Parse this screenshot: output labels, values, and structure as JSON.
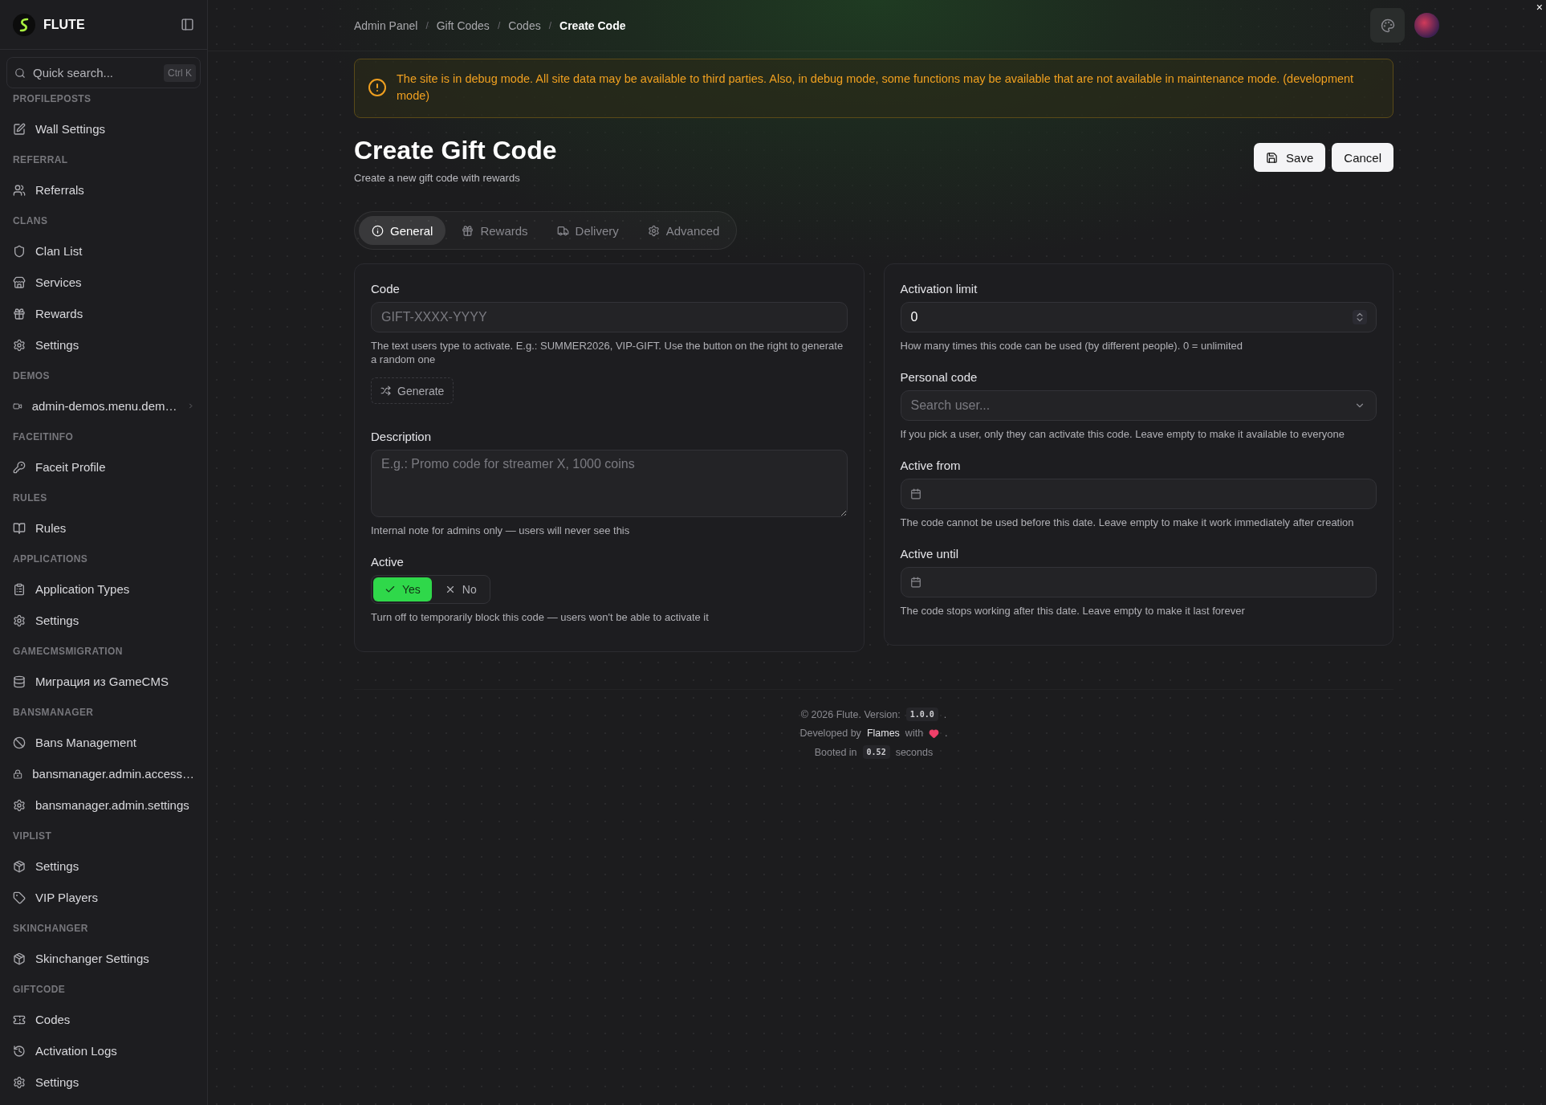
{
  "corner_close": "×",
  "sidebar": {
    "brand": "FLUTE",
    "search": {
      "placeholder": "Quick search...",
      "shortcut": "Ctrl K"
    },
    "sections": [
      {
        "title": "PROFILEPOSTS",
        "items": [
          {
            "label": "Wall Settings"
          }
        ]
      },
      {
        "title": "REFERRAL",
        "items": [
          {
            "label": "Referrals"
          }
        ]
      },
      {
        "title": "CLANS",
        "items": [
          {
            "label": "Clan List"
          },
          {
            "label": "Services"
          },
          {
            "label": "Rewards"
          },
          {
            "label": "Settings"
          }
        ]
      },
      {
        "title": "DEMOS",
        "items": [
          {
            "label": "admin-demos.menu.dem…",
            "expandable": true
          }
        ]
      },
      {
        "title": "FACEITINFO",
        "items": [
          {
            "label": "Faceit Profile"
          }
        ]
      },
      {
        "title": "RULES",
        "items": [
          {
            "label": "Rules"
          }
        ]
      },
      {
        "title": "APPLICATIONS",
        "items": [
          {
            "label": "Application Types"
          },
          {
            "label": "Settings"
          }
        ]
      },
      {
        "title": "GAMECMSMIGRATION",
        "items": [
          {
            "label": "Миграция из GameCMS"
          }
        ]
      },
      {
        "title": "BANSMANAGER",
        "items": [
          {
            "label": "Bans Management"
          },
          {
            "label": "bansmanager.admin.access…"
          },
          {
            "label": "bansmanager.admin.settings"
          }
        ]
      },
      {
        "title": "VIPLIST",
        "items": [
          {
            "label": "Settings"
          },
          {
            "label": "VIP Players"
          }
        ]
      },
      {
        "title": "SKINCHANGER",
        "items": [
          {
            "label": "Skinchanger Settings"
          }
        ]
      },
      {
        "title": "GIFTCODE",
        "items": [
          {
            "label": "Codes"
          },
          {
            "label": "Activation Logs"
          },
          {
            "label": "Settings"
          }
        ]
      }
    ]
  },
  "breadcrumbs": {
    "separator": "/",
    "items": [
      "Admin Panel",
      "Gift Codes",
      "Codes",
      "Create Code"
    ]
  },
  "alert": "The site is in debug mode. All site data may be available to third parties. Also, in debug mode, some functions may be available that are not available in maintenance mode. (development mode)",
  "page": {
    "title": "Create Gift Code",
    "subtitle": "Create a new gift code with rewards",
    "buttons": [
      {
        "label": "Save",
        "kind": "save"
      },
      {
        "label": "Cancel",
        "kind": "plain"
      }
    ]
  },
  "tabs": [
    {
      "label": "General",
      "selected": true
    },
    {
      "label": "Rewards",
      "selected": false
    },
    {
      "label": "Delivery",
      "selected": false
    },
    {
      "label": "Advanced",
      "selected": false
    }
  ],
  "columns": [
    [
      {
        "kind": "text",
        "label": "Code",
        "placeholder": "GIFT-XXXX-YYYY",
        "help": "The text users type to activate. E.g.: SUMMER2026, VIP-GIFT. Use the button on the right to generate a random one",
        "action": "Generate"
      },
      {
        "kind": "textarea",
        "label": "Description",
        "placeholder": "E.g.: Promo code for streamer X, 1000 coins",
        "help": "Internal note for admins only — users will never see this"
      },
      {
        "kind": "toggle",
        "label": "Active",
        "options": [
          {
            "label": "Yes",
            "selected": true
          },
          {
            "label": "No",
            "selected": false
          }
        ],
        "help": "Turn off to temporarily block this code — users won't be able to activate it"
      }
    ],
    [
      {
        "kind": "number",
        "label": "Activation limit",
        "value": "0",
        "help": "How many times this code can be used (by different people). 0 = unlimited"
      },
      {
        "kind": "select",
        "label": "Personal code",
        "placeholder": "Search user...",
        "help": "If you pick a user, only they can activate this code. Leave empty to make it available to everyone"
      },
      {
        "kind": "date",
        "label": "Active from",
        "help": "The code cannot be used before this date. Leave empty to make it work immediately after creation"
      },
      {
        "kind": "date",
        "label": "Active until",
        "help": "The code stops working after this date. Leave empty to make it last forever"
      }
    ]
  ],
  "footer": {
    "copyright": "© 2026 Flute. Version:",
    "version": "1.0.0",
    "dot": ".",
    "developed": "Developed by",
    "author": "Flames",
    "with": "with",
    "dot2": ".",
    "booted": "Booted in",
    "time": "0.52",
    "seconds": "seconds"
  }
}
